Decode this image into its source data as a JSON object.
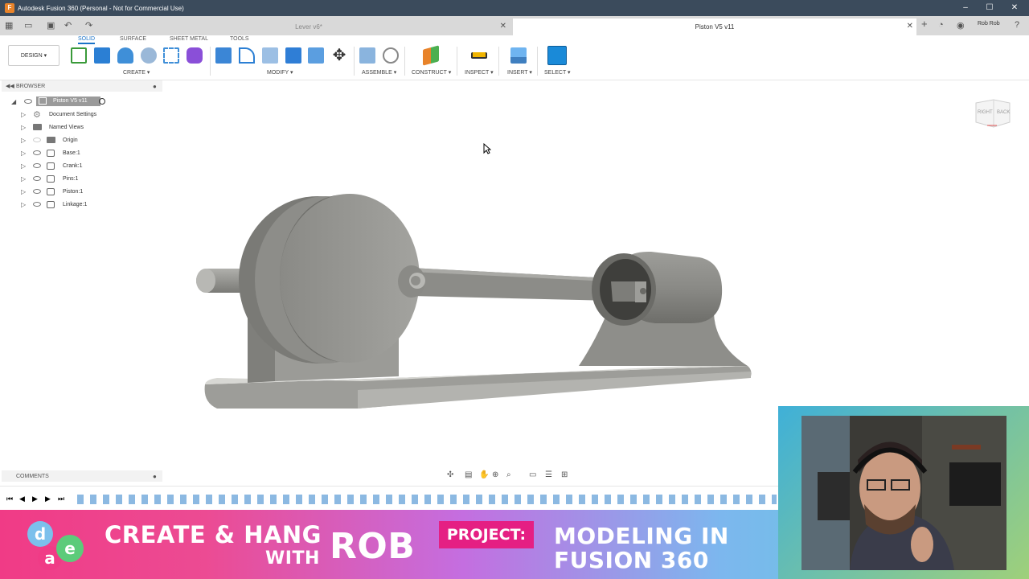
{
  "window": {
    "title": "Autodesk Fusion 360 (Personal - Not for Commercial Use)",
    "controls": {
      "minimize": "–",
      "maximize": "☐",
      "close": "✕"
    }
  },
  "tabs": [
    {
      "label": "Lever v6*",
      "active": false
    },
    {
      "label": "Piston V5 v11",
      "active": true
    }
  ],
  "account": {
    "user": "Rob Rob"
  },
  "toolbar": {
    "workspace": "DESIGN",
    "workspace_tabs": [
      "SOLID",
      "SURFACE",
      "SHEET METAL",
      "TOOLS"
    ],
    "groups": {
      "create": "CREATE",
      "modify": "MODIFY",
      "assemble": "ASSEMBLE",
      "construct": "CONSTRUCT",
      "inspect": "INSPECT",
      "insert": "INSERT",
      "select": "SELECT"
    },
    "accent": "#1a73c7"
  },
  "browser": {
    "title": "BROWSER",
    "root": "Piston V5 v11",
    "items": [
      {
        "label": "Document Settings"
      },
      {
        "label": "Named Views"
      },
      {
        "label": "Origin"
      },
      {
        "label": "Base:1"
      },
      {
        "label": "Crank:1"
      },
      {
        "label": "Pins:1"
      },
      {
        "label": "Piston:1"
      },
      {
        "label": "Linkage:1"
      }
    ]
  },
  "comments": {
    "title": "COMMENTS"
  },
  "viewcube": {
    "faces": [
      "RIGHT",
      "BACK"
    ]
  },
  "banner": {
    "line1": "CREATE & HANG",
    "line2_small": "WITH",
    "line2_big": "ROB",
    "project_label": "PROJECT:",
    "project_line1": "MODELING IN",
    "project_line2": "FUSION 360",
    "logo_letters": [
      "d",
      "a",
      "e"
    ],
    "gradient": [
      "#f03b86",
      "#c46ee0",
      "#5ed0d9"
    ]
  }
}
